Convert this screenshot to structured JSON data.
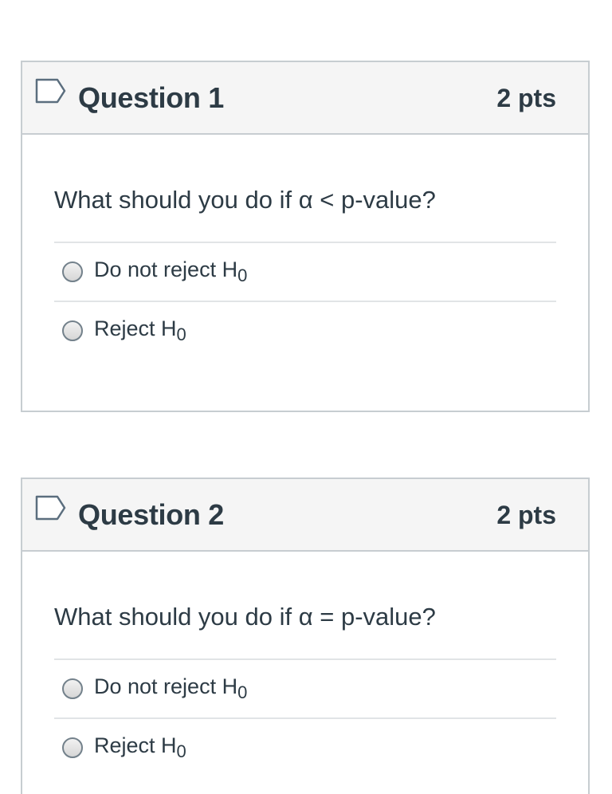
{
  "questions": [
    {
      "title": "Question 1",
      "points": "2 pts",
      "text": "What should you do if α < p-value?",
      "answers": [
        {
          "label": "Do not reject H",
          "subscript": "0"
        },
        {
          "label": "Reject H",
          "subscript": "0"
        }
      ]
    },
    {
      "title": "Question 2",
      "points": "2 pts",
      "text": "What should you do if α = p-value?",
      "answers": [
        {
          "label": "Do not reject H",
          "subscript": "0"
        },
        {
          "label": "Reject H",
          "subscript": "0"
        }
      ]
    }
  ],
  "colors": {
    "flag_border": "#5b6e7e",
    "header_bg": "#f5f5f5",
    "border": "#c7cdd1",
    "text": "#2d3b45"
  },
  "icons": {
    "flag": "flag-icon"
  }
}
